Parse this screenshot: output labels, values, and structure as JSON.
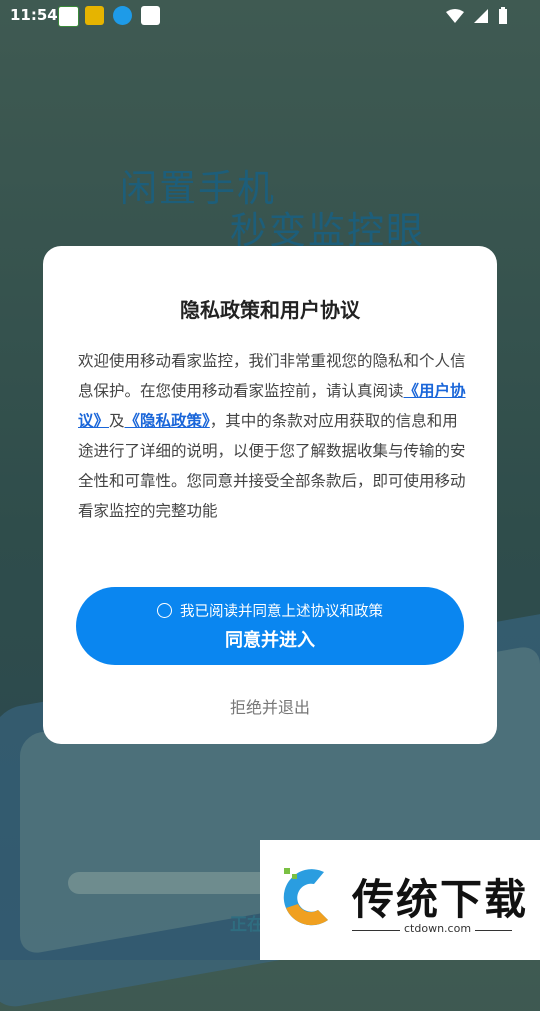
{
  "status_bar": {
    "time": "11:54"
  },
  "background": {
    "headline_line1": "闲置手机",
    "headline_line2": "秒变监控眼",
    "status_text": "正在"
  },
  "dialog": {
    "title": "隐私政策和用户协议",
    "body_pre": "欢迎使用移动看家监控，我们非常重视您的隐私和个人信息保护。在您使用移动看家监控前，请认真阅读",
    "link_user_agreement": "《用户协议》",
    "and": "及",
    "link_privacy_policy": "《隐私政策》",
    "body_post": "，其中的条款对应用获取的信息和用途进行了详细的说明，以便于您了解数据收集与传输的安全性和可靠性。您同意并接受全部条款后，即可使用移动看家监控的完整功能",
    "checkbox_label": "我已阅读并同意上述协议和政策",
    "agree_button": "同意并进入",
    "reject_button": "拒绝并退出"
  },
  "watermark": {
    "brand": "传统下载",
    "url": "ctdown.com"
  }
}
